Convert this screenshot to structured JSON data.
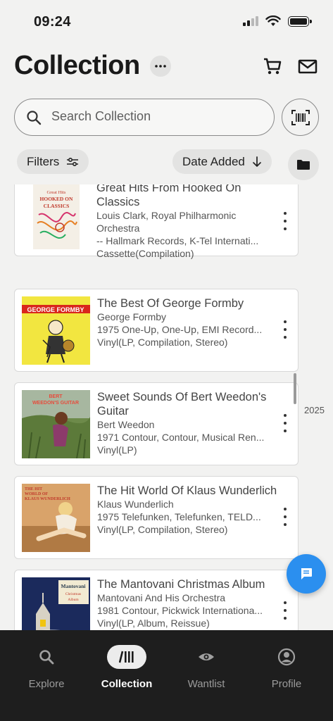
{
  "status": {
    "time": "09:24"
  },
  "header": {
    "title": "Collection",
    "more_icon": "ellipsis-icon",
    "cart_icon": "cart-icon",
    "mail_icon": "mail-icon"
  },
  "search": {
    "placeholder": "Search Collection"
  },
  "filters": {
    "filters_label": "Filters",
    "sort_label": "Date Added"
  },
  "scroll": {
    "year": "2025"
  },
  "records": [
    {
      "title": "Great Hits From Hooked On Classics",
      "artist": "Louis Clark, Royal Philharmonic Orchestra",
      "release": "-- Hallmark Records, K-Tel Internati...",
      "format": "Cassette(Compilation)",
      "cover_text": "Great Hits HOOKED ON CLASSICS"
    },
    {
      "title": "The Best Of George Formby",
      "artist": "George Formby",
      "release": "1975 One-Up, One-Up, EMI Record...",
      "format": "Vinyl(LP, Compilation, Stereo)",
      "cover_text": "GEORGE FORMBY"
    },
    {
      "title": "Sweet Sounds Of Bert Weedon's Guitar",
      "artist": "Bert Weedon",
      "release": "1971 Contour, Contour, Musical Ren...",
      "format": "Vinyl(LP)",
      "cover_text": "BERT WEEDON'S GUITAR"
    },
    {
      "title": "The Hit World Of Klaus Wunderlich",
      "artist": "Klaus Wunderlich",
      "release": "1975 Telefunken, Telefunken, TELD...",
      "format": "Vinyl(LP, Compilation, Stereo)",
      "cover_text": "THE HIT WORLD OF KLAUS WUNDERLICH"
    },
    {
      "title": "The Mantovani Christmas Album",
      "artist": "Mantovani And His Orchestra",
      "release": "1981 Contour, Pickwick Internationa...",
      "format": "Vinyl(LP, Album, Reissue)",
      "cover_text": "Mantovani Christmas Album"
    }
  ],
  "tabs": [
    {
      "label": "Explore",
      "icon": "search-icon"
    },
    {
      "label": "Collection",
      "icon": "collection-icon"
    },
    {
      "label": "Wantlist",
      "icon": "eye-icon"
    },
    {
      "label": "Profile",
      "icon": "profile-icon"
    }
  ],
  "colors": {
    "accent": "#2b8fef",
    "tabbar": "#1e1e1e",
    "background": "#f2f2f1"
  }
}
